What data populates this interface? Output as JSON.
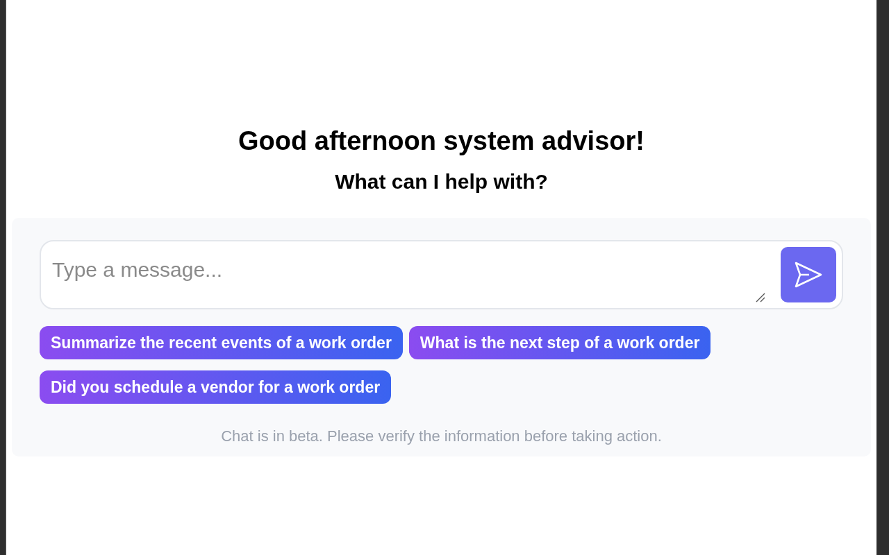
{
  "greeting": "Good afternoon system advisor!",
  "subtitle": "What can I help with?",
  "composer": {
    "placeholder": "Type a message..."
  },
  "suggestions": [
    "Summarize the recent events of a work order",
    "What is the next step of a work order",
    "Did you schedule a vendor for a work order"
  ],
  "disclaimer": "Chat is in beta. Please verify the information before taking action."
}
